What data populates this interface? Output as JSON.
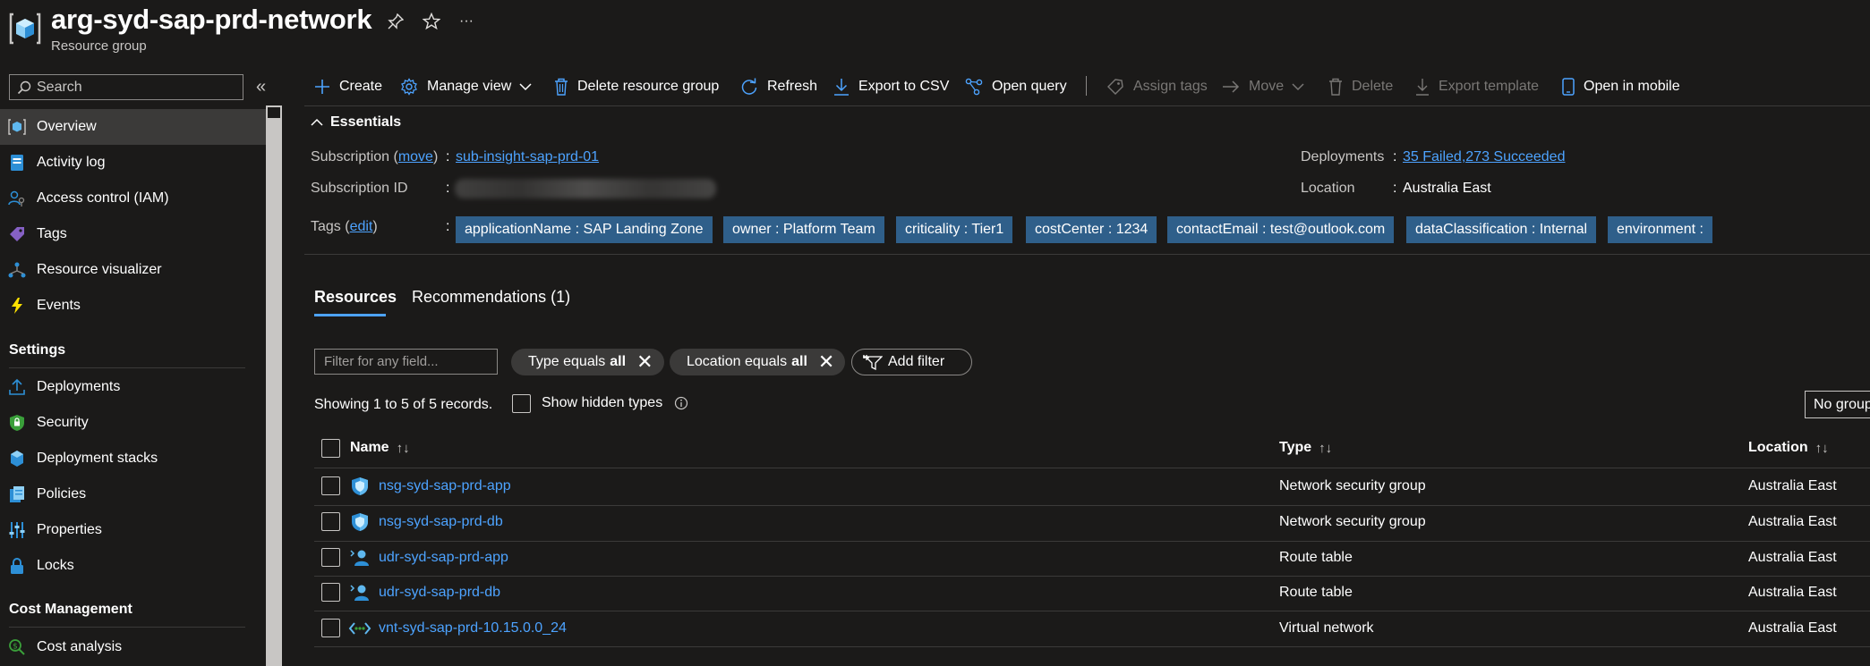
{
  "header": {
    "title": "arg-syd-sap-prd-network",
    "subtitle": "Resource group",
    "pin_icon": "pin-icon",
    "favorite_icon": "star-icon",
    "more_label": "···"
  },
  "sidebar": {
    "search_placeholder": "Search",
    "collapse_label": "«",
    "items": [
      {
        "label": "Overview",
        "icon": "resource-group-icon",
        "selected": true
      },
      {
        "label": "Activity log",
        "icon": "activity-log-icon"
      },
      {
        "label": "Access control (IAM)",
        "icon": "iam-icon"
      },
      {
        "label": "Tags",
        "icon": "tag-icon"
      },
      {
        "label": "Resource visualizer",
        "icon": "visualizer-icon"
      },
      {
        "label": "Events",
        "icon": "lightning-icon"
      }
    ],
    "settings_heading": "Settings",
    "settings_items": [
      {
        "label": "Deployments",
        "icon": "deployments-icon"
      },
      {
        "label": "Security",
        "icon": "shield-icon"
      },
      {
        "label": "Deployment stacks",
        "icon": "stack-icon"
      },
      {
        "label": "Policies",
        "icon": "policy-icon"
      },
      {
        "label": "Properties",
        "icon": "properties-icon"
      },
      {
        "label": "Locks",
        "icon": "lock-icon"
      }
    ],
    "cost_heading": "Cost Management",
    "cost_items": [
      {
        "label": "Cost analysis",
        "icon": "cost-analysis-icon"
      }
    ]
  },
  "commandbar": {
    "create": "Create",
    "manage_view": "Manage view",
    "delete_rg": "Delete resource group",
    "refresh": "Refresh",
    "export_csv": "Export to CSV",
    "open_query": "Open query",
    "assign_tags": "Assign tags",
    "move": "Move",
    "delete": "Delete",
    "export_template": "Export template",
    "open_mobile": "Open in mobile"
  },
  "essentials": {
    "title": "Essentials",
    "subscription_label": "Subscription",
    "subscription_move": "move",
    "subscription_value": "sub-insight-sap-prd-01",
    "subscription_id_label": "Subscription ID",
    "tags_label": "Tags",
    "tags_edit": "edit",
    "deployments_label": "Deployments",
    "deployments_value": "35 Failed,273 Succeeded",
    "location_label": "Location",
    "location_value": "Australia East",
    "colon": ":",
    "tags": [
      "applicationName : SAP Landing Zone",
      "owner : Platform Team",
      "criticality : Tier1",
      "costCenter : 1234",
      "contactEmail : test@outlook.com",
      "dataClassification : Internal",
      "environment :"
    ]
  },
  "tabs": {
    "resources": "Resources",
    "recommendations": "Recommendations (1)"
  },
  "filters": {
    "placeholder": "Filter for any field...",
    "type_pill_prefix": "Type equals",
    "type_pill_value": "all",
    "location_pill_prefix": "Location equals",
    "location_pill_value": "all",
    "add_filter": "Add filter",
    "close_glyph": "✕"
  },
  "records": {
    "showing": "Showing 1 to 5 of 5 records.",
    "show_hidden": "Show hidden types",
    "grouping": "No group"
  },
  "table": {
    "columns": {
      "name": "Name",
      "type": "Type",
      "location": "Location",
      "sort_glyph": "↑↓"
    },
    "rows": [
      {
        "name": "nsg-syd-sap-prd-app",
        "type": "Network security group",
        "location": "Australia East",
        "icon": "nsg-icon"
      },
      {
        "name": "nsg-syd-sap-prd-db",
        "type": "Network security group",
        "location": "Australia East",
        "icon": "nsg-icon"
      },
      {
        "name": "udr-syd-sap-prd-app",
        "type": "Route table",
        "location": "Australia East",
        "icon": "route-table-icon"
      },
      {
        "name": "udr-syd-sap-prd-db",
        "type": "Route table",
        "location": "Australia East",
        "icon": "route-table-icon"
      },
      {
        "name": "vnt-syd-sap-prd-10.15.0.0_24",
        "type": "Virtual network",
        "location": "Australia East",
        "icon": "vnet-icon"
      }
    ]
  },
  "colors": {
    "background": "#1b1a19",
    "link": "#4da3ff",
    "tag_bg": "#2f5f8a",
    "selected_nav": "#3b3a39"
  }
}
